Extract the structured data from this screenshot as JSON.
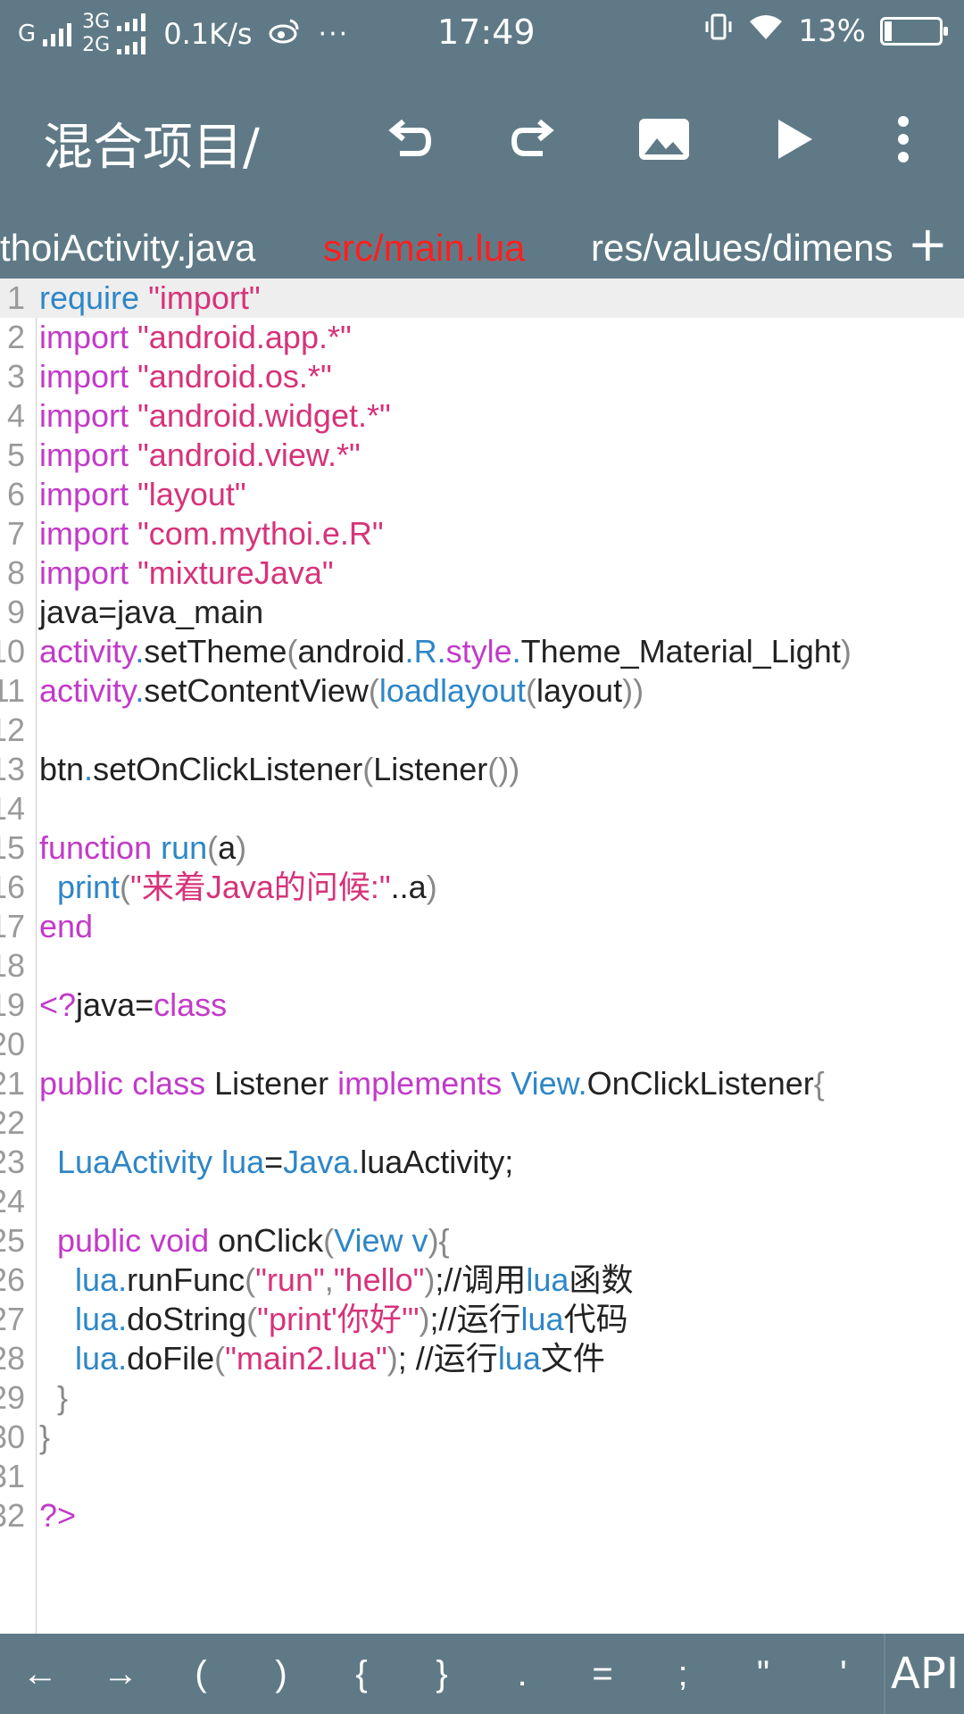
{
  "status": {
    "carrier_label": "G",
    "net_3g": "3G",
    "net_2g": "2G",
    "net_speed": "0.1K/s",
    "more": "···",
    "time": "17:49",
    "battery_percent": "13%",
    "battery_level": 0.13
  },
  "app_bar": {
    "title": "混合项目/",
    "icons": [
      "undo-icon",
      "redo-icon",
      "image-icon",
      "play-icon",
      "more-vert-icon"
    ]
  },
  "tabs": {
    "items": [
      {
        "label": "thoiActivity.java",
        "active": false
      },
      {
        "label": "src/main.lua",
        "active": true
      },
      {
        "label": "res/values/dimens",
        "active": false
      }
    ],
    "add_label": "+"
  },
  "editor": {
    "lines": [
      {
        "n": "1",
        "tokens": [
          [
            "fn",
            "require "
          ],
          [
            "str",
            "\"import\""
          ]
        ]
      },
      {
        "n": "2",
        "tokens": [
          [
            "kw",
            "import "
          ],
          [
            "str",
            "\"android.app.*\""
          ]
        ]
      },
      {
        "n": "3",
        "tokens": [
          [
            "kw",
            "import "
          ],
          [
            "str",
            "\"android.os.*\""
          ]
        ]
      },
      {
        "n": "4",
        "tokens": [
          [
            "kw",
            "import "
          ],
          [
            "str",
            "\"android.widget.*\""
          ]
        ]
      },
      {
        "n": "5",
        "tokens": [
          [
            "kw",
            "import "
          ],
          [
            "str",
            "\"android.view.*\""
          ]
        ]
      },
      {
        "n": "6",
        "tokens": [
          [
            "kw",
            "import "
          ],
          [
            "str",
            "\"layout\""
          ]
        ]
      },
      {
        "n": "7",
        "tokens": [
          [
            "kw",
            "import "
          ],
          [
            "str",
            "\"com.mythoi.e.R\""
          ]
        ]
      },
      {
        "n": "8",
        "tokens": [
          [
            "kw",
            "import "
          ],
          [
            "str",
            "\"mixtureJava\""
          ]
        ]
      },
      {
        "n": "9",
        "tokens": [
          [
            "id",
            "java=java_main"
          ]
        ]
      },
      {
        "n": "10",
        "tokens": [
          [
            "kw",
            "activity"
          ],
          [
            "op",
            "."
          ],
          [
            "id",
            "setTheme"
          ],
          [
            "br",
            "("
          ],
          [
            "id",
            "android"
          ],
          [
            "op",
            "."
          ],
          [
            "fn",
            "R"
          ],
          [
            "op",
            "."
          ],
          [
            "kw",
            "style"
          ],
          [
            "op",
            "."
          ],
          [
            "id",
            "Theme_Material_Light"
          ],
          [
            "br",
            ")"
          ]
        ]
      },
      {
        "n": "11",
        "tokens": [
          [
            "kw",
            "activity"
          ],
          [
            "op",
            "."
          ],
          [
            "id",
            "setContentView"
          ],
          [
            "br",
            "("
          ],
          [
            "fn",
            "loadlayout"
          ],
          [
            "br",
            "("
          ],
          [
            "id",
            "layout"
          ],
          [
            "br",
            "))"
          ]
        ]
      },
      {
        "n": "12",
        "tokens": []
      },
      {
        "n": "13",
        "tokens": [
          [
            "id",
            "btn"
          ],
          [
            "op",
            "."
          ],
          [
            "id",
            "setOnClickListener"
          ],
          [
            "br",
            "("
          ],
          [
            "id",
            "Listener"
          ],
          [
            "br",
            "())"
          ]
        ]
      },
      {
        "n": "14",
        "tokens": []
      },
      {
        "n": "15",
        "tokens": [
          [
            "kw",
            "function "
          ],
          [
            "fn",
            "run"
          ],
          [
            "br",
            "("
          ],
          [
            "id",
            "a"
          ],
          [
            "br",
            ")"
          ]
        ]
      },
      {
        "n": "16",
        "tokens": [
          [
            "id",
            "  "
          ],
          [
            "fn",
            "print"
          ],
          [
            "br",
            "("
          ],
          [
            "str",
            "\"来着Java的问候:\""
          ],
          [
            "id",
            "..a"
          ],
          [
            "br",
            ")"
          ]
        ]
      },
      {
        "n": "17",
        "tokens": [
          [
            "kw",
            "end"
          ]
        ]
      },
      {
        "n": "18",
        "tokens": []
      },
      {
        "n": "19",
        "tokens": [
          [
            "kw",
            "<?"
          ],
          [
            "id",
            "java="
          ],
          [
            "kw",
            "class"
          ]
        ]
      },
      {
        "n": "20",
        "tokens": []
      },
      {
        "n": "21",
        "tokens": [
          [
            "kw",
            "public class "
          ],
          [
            "id",
            "Listener "
          ],
          [
            "kw",
            "implements "
          ],
          [
            "fn",
            "View"
          ],
          [
            "op",
            "."
          ],
          [
            "id",
            "OnClickListener"
          ],
          [
            "br",
            "{"
          ]
        ]
      },
      {
        "n": "22",
        "tokens": []
      },
      {
        "n": "23",
        "tokens": [
          [
            "id",
            "  "
          ],
          [
            "fn",
            "LuaActivity lua"
          ],
          [
            "id",
            "="
          ],
          [
            "fn",
            "Java"
          ],
          [
            "op",
            "."
          ],
          [
            "id",
            "luaActivity;"
          ]
        ]
      },
      {
        "n": "24",
        "tokens": []
      },
      {
        "n": "25",
        "tokens": [
          [
            "id",
            "  "
          ],
          [
            "kw",
            "public void "
          ],
          [
            "id",
            "onClick"
          ],
          [
            "br",
            "("
          ],
          [
            "fn",
            "View v"
          ],
          [
            "br",
            "){"
          ]
        ]
      },
      {
        "n": "26",
        "tokens": [
          [
            "id",
            "    "
          ],
          [
            "fn",
            "lua"
          ],
          [
            "op",
            "."
          ],
          [
            "id",
            "runFunc"
          ],
          [
            "br",
            "("
          ],
          [
            "str",
            "\"run\""
          ],
          [
            "br",
            ","
          ],
          [
            "str",
            "\"hello\""
          ],
          [
            "br",
            ")"
          ],
          [
            "id",
            ";//调用"
          ],
          [
            "fn",
            "lua"
          ],
          [
            "id",
            "函数"
          ]
        ]
      },
      {
        "n": "27",
        "tokens": [
          [
            "id",
            "    "
          ],
          [
            "fn",
            "lua"
          ],
          [
            "op",
            "."
          ],
          [
            "id",
            "doString"
          ],
          [
            "br",
            "("
          ],
          [
            "str",
            "\"print'你好'\""
          ],
          [
            "br",
            ")"
          ],
          [
            "id",
            ";//运行"
          ],
          [
            "fn",
            "lua"
          ],
          [
            "id",
            "代码"
          ]
        ]
      },
      {
        "n": "28",
        "tokens": [
          [
            "id",
            "    "
          ],
          [
            "fn",
            "lua"
          ],
          [
            "op",
            "."
          ],
          [
            "id",
            "doFile"
          ],
          [
            "br",
            "("
          ],
          [
            "str",
            "\"main2.lua\""
          ],
          [
            "br",
            ")"
          ],
          [
            "id",
            "; //运行"
          ],
          [
            "fn",
            "lua"
          ],
          [
            "id",
            "文件"
          ]
        ]
      },
      {
        "n": "29",
        "tokens": [
          [
            "br",
            "  }"
          ]
        ]
      },
      {
        "n": "30",
        "tokens": [
          [
            "br",
            "}"
          ]
        ]
      },
      {
        "n": "31",
        "tokens": []
      },
      {
        "n": "32",
        "tokens": [
          [
            "kw",
            "?>"
          ]
        ]
      }
    ]
  },
  "symbols": [
    "←",
    "→",
    "(",
    ")",
    "{",
    "}",
    ".",
    "=",
    ";",
    "\"",
    "'"
  ],
  "api_label": "API",
  "colors": {
    "bar": "#5f7a86",
    "active_tab": "#ff1e1e",
    "keyword": "#c23ac9",
    "string": "#d6337a",
    "function": "#2e86c7"
  }
}
